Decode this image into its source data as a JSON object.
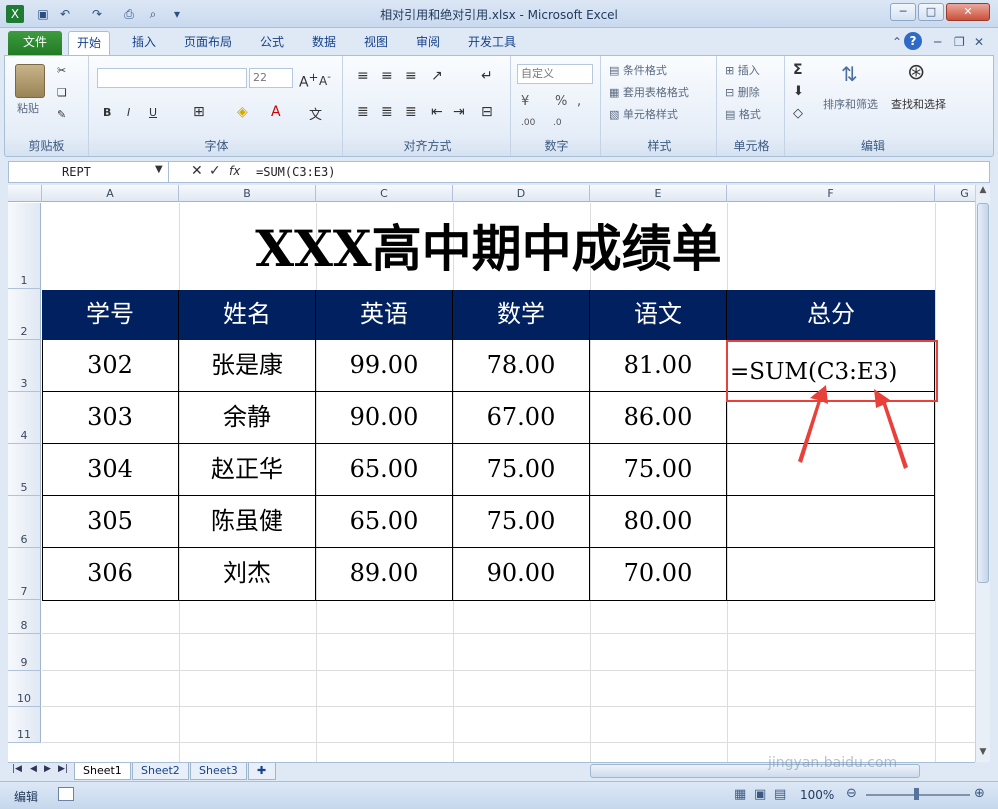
{
  "window": {
    "title": "相对引用和绝对引用.xlsx - Microsoft Excel",
    "min_label": "─",
    "max_label": "□",
    "close_label": "✕"
  },
  "ribbon_tabs": [
    "文件",
    "开始",
    "插入",
    "页面布局",
    "公式",
    "数据",
    "视图",
    "审阅",
    "开发工具"
  ],
  "ribbon": {
    "clipboard": {
      "paste": "粘贴",
      "label": "剪贴板"
    },
    "font": {
      "font_name": "",
      "font_size": "22",
      "label": "字体"
    },
    "alignment": {
      "label": "对齐方式"
    },
    "number": {
      "format": "自定义",
      "percent": "%",
      "label": "数字"
    },
    "styles": {
      "cond": "条件格式",
      "table": "套用表格格式",
      "cell": "单元格样式",
      "label": "样式"
    },
    "cells": {
      "insert": "插入",
      "delete": "删除",
      "format": "格式",
      "label": "单元格"
    },
    "editing": {
      "sum": "Σ",
      "sort": "排序和筛选",
      "find": "查找和选择",
      "label": "编辑"
    }
  },
  "formula_bar": {
    "name_box": "REPT",
    "fx": "fx",
    "formula": "=SUM(C3:E3)"
  },
  "columns": [
    "A",
    "B",
    "C",
    "D",
    "E",
    "F",
    "G"
  ],
  "rows": [
    "1",
    "2",
    "3",
    "4",
    "5",
    "6",
    "7",
    "8",
    "9",
    "10",
    "11"
  ],
  "sheet": {
    "title": "XXX高中期中成绩单",
    "headers": [
      "学号",
      "姓名",
      "英语",
      "数学",
      "语文",
      "总分"
    ],
    "records": [
      [
        "302",
        "张是康",
        "99.00",
        "78.00",
        "81.00"
      ],
      [
        "303",
        "余静",
        "90.00",
        "67.00",
        "86.00"
      ],
      [
        "304",
        "赵正华",
        "65.00",
        "75.00",
        "75.00"
      ],
      [
        "305",
        "陈虽健",
        "65.00",
        "75.00",
        "80.00"
      ],
      [
        "306",
        "刘杰",
        "89.00",
        "90.00",
        "70.00"
      ]
    ],
    "editing_cell": "=SUM(C3:E3)"
  },
  "sheet_tabs": [
    "Sheet1",
    "Sheet2",
    "Sheet3"
  ],
  "status": {
    "mode": "编辑",
    "zoom": "100%"
  },
  "watermark": "jingyan.baidu.com",
  "colors": {
    "header_fill": "#002060",
    "highlight": "#e8413b",
    "file_tab": "#217b24"
  }
}
